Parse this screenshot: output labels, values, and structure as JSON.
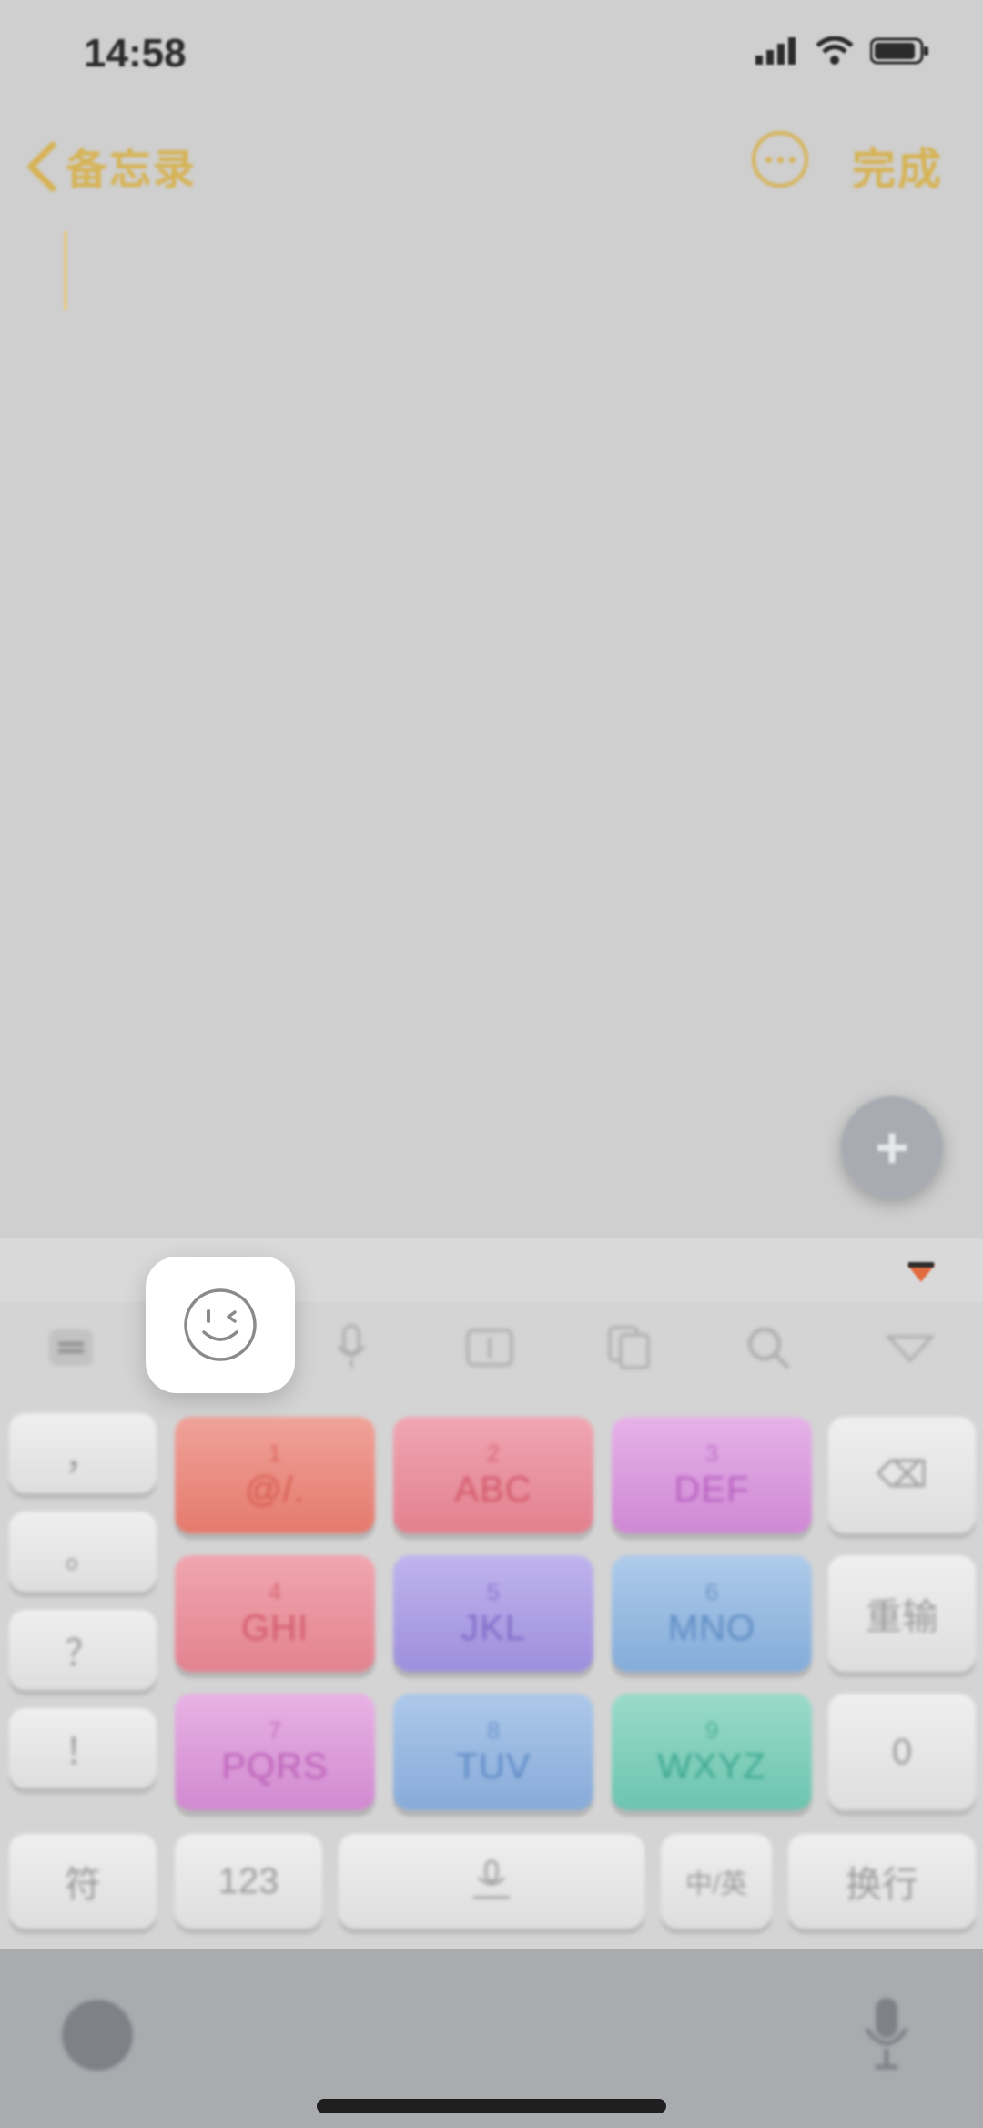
{
  "status_bar": {
    "time": "14:58"
  },
  "nav": {
    "back_label": "备忘录",
    "done_label": "完成"
  },
  "keyboard": {
    "grid": [
      {
        "num": "1",
        "letters": "@/."
      },
      {
        "num": "2",
        "letters": "ABC"
      },
      {
        "num": "3",
        "letters": "DEF"
      },
      {
        "num": "4",
        "letters": "GHI"
      },
      {
        "num": "5",
        "letters": "JKL"
      },
      {
        "num": "6",
        "letters": "MNO"
      },
      {
        "num": "7",
        "letters": "PQRS"
      },
      {
        "num": "8",
        "letters": "TUV"
      },
      {
        "num": "9",
        "letters": "WXYZ"
      }
    ],
    "left_col": [
      "，",
      "。",
      "？",
      "！"
    ],
    "right_col": {
      "delete": "⌫",
      "reenter": "重输",
      "zero": "0"
    },
    "bottom_row": {
      "symbol": "符",
      "num_switch": "123",
      "space": "",
      "lang_switch": "中/英",
      "return": "换行"
    }
  },
  "colors": {
    "accent": "#d6b252",
    "key_red": "#e8867a",
    "key_pink": "#e48a9c",
    "key_magenta": "#d49ad8",
    "key_violet": "#a59ae0",
    "key_blue": "#8fb4df",
    "key_teal": "#6cc4b0"
  }
}
